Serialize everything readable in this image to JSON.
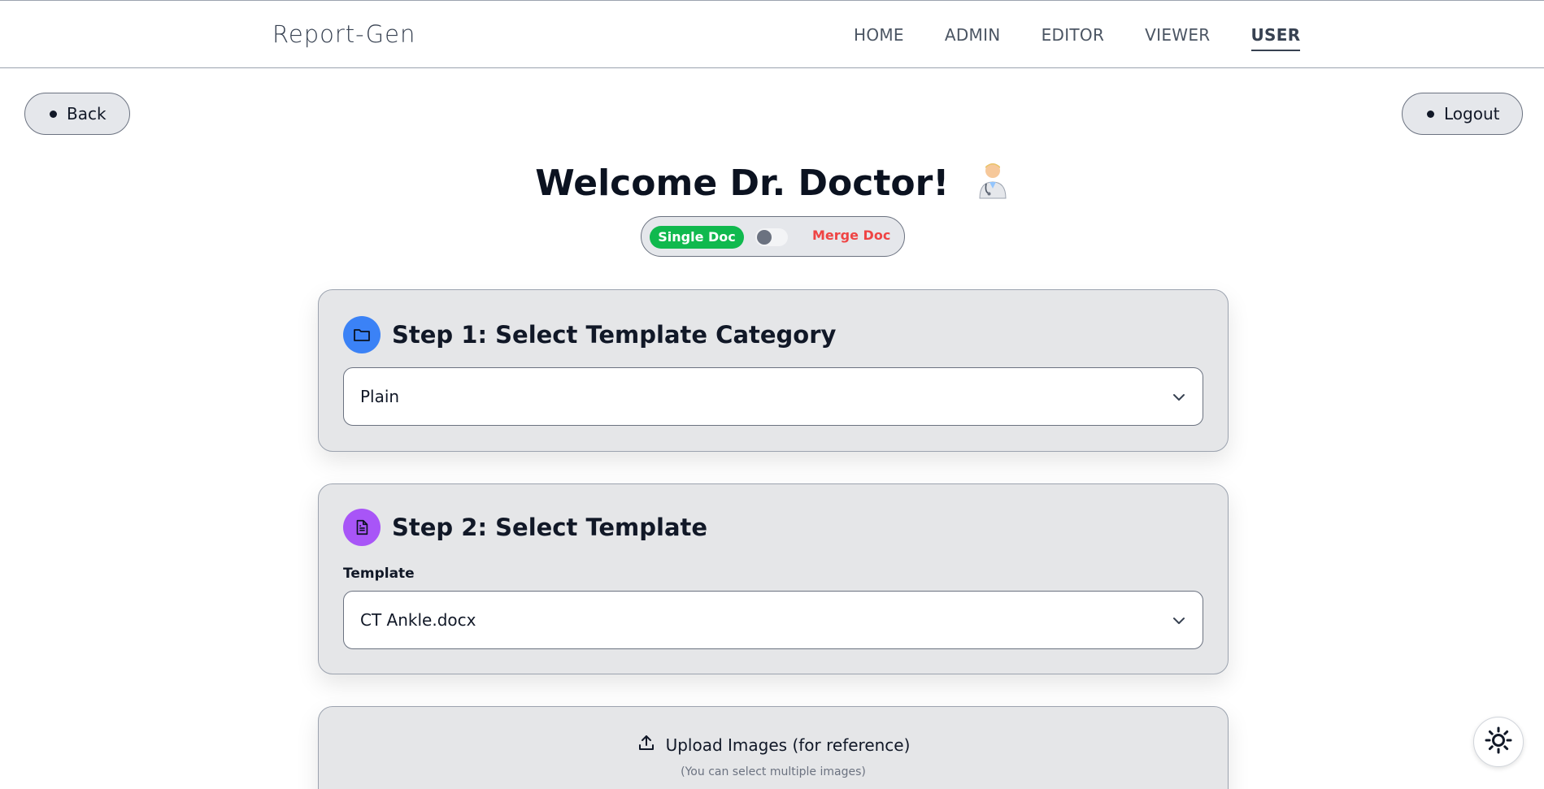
{
  "navbar": {
    "brand": "Report-Gen",
    "links": [
      {
        "label": "HOME",
        "active": false
      },
      {
        "label": "ADMIN",
        "active": false
      },
      {
        "label": "EDITOR",
        "active": false
      },
      {
        "label": "VIEWER",
        "active": false
      },
      {
        "label": "USER",
        "active": true
      }
    ]
  },
  "actions": {
    "back_label": "Back",
    "logout_label": "Logout"
  },
  "welcome": {
    "title": "Welcome Dr. Doctor!",
    "icon": "doctor-icon"
  },
  "mode_toggle": {
    "single_label": "Single Doc",
    "merge_label": "Merge Doc",
    "selected": "Single Doc"
  },
  "step1": {
    "title": "Step 1: Select Template Category",
    "icon": "folder-icon",
    "selected_value": "Plain"
  },
  "step2": {
    "title": "Step 2: Select Template",
    "icon": "document-icon",
    "field_label": "Template",
    "selected_value": "CT Ankle.docx"
  },
  "upload": {
    "label": "Upload Images (for reference)",
    "hint": "(You can select multiple images)",
    "icon": "upload-icon"
  },
  "theme_toggle": {
    "icon": "sun-icon"
  },
  "colors": {
    "single_doc_green": "#10b94e",
    "merge_doc_red": "#ef4444",
    "step1_blue": "#3b82f6",
    "step2_purple": "#a855f7",
    "card_bg": "#e5e6e8"
  }
}
